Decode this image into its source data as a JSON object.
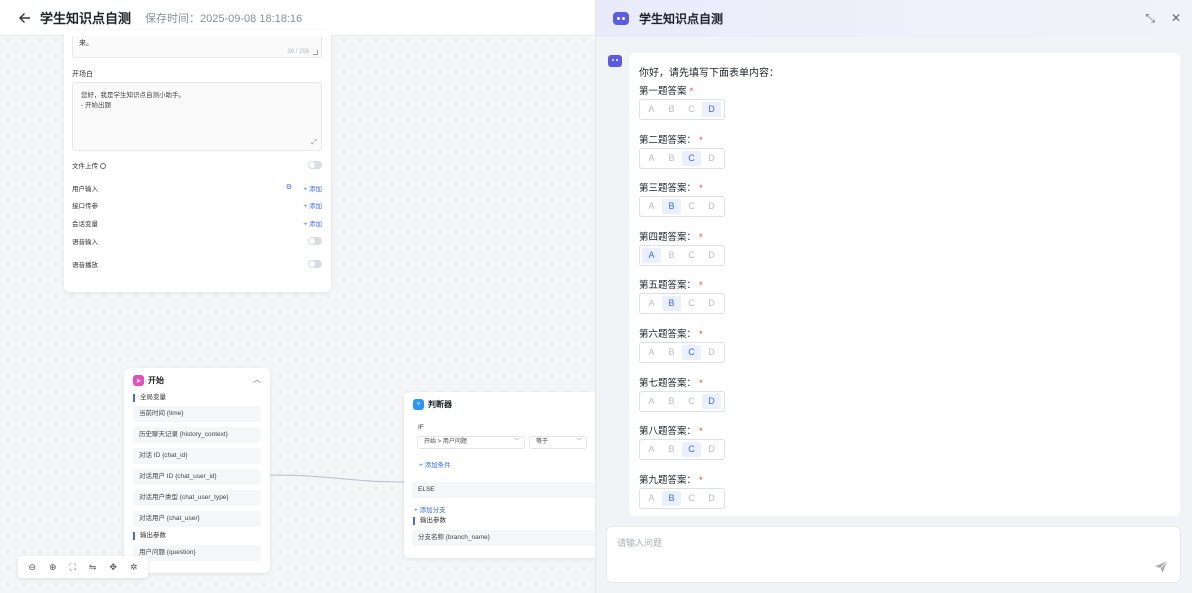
{
  "topbar": {
    "title": "学生知识点自测",
    "save_time": "保存时间：2025-09-08 18:18:16"
  },
  "settings": {
    "textarea_top_text": "来。",
    "counter": "39 / 256",
    "opening_label": "开场白",
    "opening_lines": [
      "您好，我是学生知识点自测小助手。",
      "- 开始出题"
    ],
    "file_upload": "文件上传",
    "user_input": "用户输入",
    "api_params": "接口传参",
    "session_vars": "会话变量",
    "voice_input": "语音输入",
    "voice_play": "语音播放",
    "add": "+ 添加"
  },
  "start_node": {
    "title": "开始",
    "global_vars_label": "全局变量",
    "vars": [
      "当前时间 {time}",
      "历史聊天记录 {history_context}",
      "对话 ID {chat_id}",
      "对话用户 ID {chat_user_id}",
      "对话用户类型 {chat_user_type}",
      "对话用户 {chat_user}"
    ],
    "output_label": "输出参数",
    "outputs": [
      "用户问题 {question}"
    ]
  },
  "judge_node": {
    "title": "判断器",
    "if_label": "IF",
    "condition_field": "开始 > 用户问题",
    "operator": "等于",
    "add_condition": "+ 添加条件",
    "else_label": "ELSE",
    "add_branch": "+ 添加分支",
    "output_label": "输出参数",
    "output_item": "分支名称 {branch_name}"
  },
  "chat": {
    "title": "学生知识点自测",
    "greeting": "你好，请先填写下面表单内容：",
    "options": [
      "A",
      "B",
      "C",
      "D"
    ],
    "questions": [
      {
        "label": "第一题答案",
        "selected": "D"
      },
      {
        "label": "第二题答案：",
        "selected": "C"
      },
      {
        "label": "第三题答案：",
        "selected": "B"
      },
      {
        "label": "第四题答案：",
        "selected": "A"
      },
      {
        "label": "第五题答案：",
        "selected": "B"
      },
      {
        "label": "第六题答案：",
        "selected": "C"
      },
      {
        "label": "第七题答案：",
        "selected": "D"
      },
      {
        "label": "第八题答案：",
        "selected": "C"
      },
      {
        "label": "第九题答案：",
        "selected": "B"
      }
    ],
    "input_placeholder": "请输入问题"
  },
  "colors": {
    "accent": "#3b6cf0",
    "bot": "#5b5ce6",
    "required": "#f04438"
  }
}
